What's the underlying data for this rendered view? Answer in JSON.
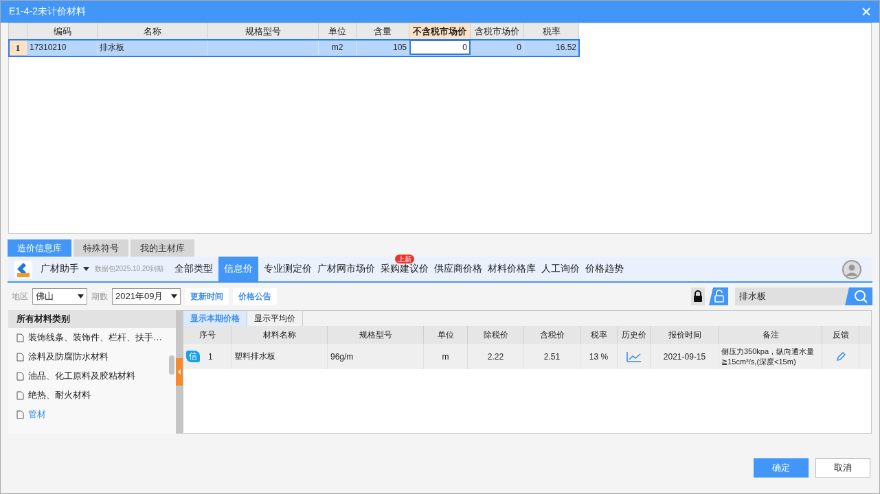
{
  "window": {
    "title": "E1-4-2未计价材料"
  },
  "top_table": {
    "columns": [
      {
        "label": "编码",
        "highlighted": false
      },
      {
        "label": "名称",
        "highlighted": false
      },
      {
        "label": "规格型号",
        "highlighted": false
      },
      {
        "label": "单位",
        "highlighted": false
      },
      {
        "label": "含量",
        "highlighted": false
      },
      {
        "label": "不含税市场价",
        "highlighted": true
      },
      {
        "label": "含税市场价",
        "highlighted": false
      },
      {
        "label": "税率",
        "highlighted": false
      }
    ],
    "rows": [
      {
        "number": "1",
        "selected": true,
        "cells": [
          "17310210",
          "排水板",
          "",
          "m2",
          "105",
          "0",
          "0",
          "16.52"
        ]
      }
    ]
  },
  "bottom_tabs": [
    {
      "label": "造价信息库",
      "selected": true
    },
    {
      "label": "特殊符号",
      "selected": false
    },
    {
      "label": "我的主材库",
      "selected": false
    }
  ],
  "assistant": {
    "name": "广材助手",
    "note": "数据包2025.10.20到期"
  },
  "nav": [
    {
      "label": "全部类型",
      "selected": false
    },
    {
      "label": "信息价",
      "selected": true
    },
    {
      "label": "专业测定价",
      "selected": false
    },
    {
      "label": "广材网市场价",
      "selected": false
    },
    {
      "label": "采购建议价",
      "selected": false,
      "badge": "上新"
    },
    {
      "label": "供应商价格",
      "selected": false
    },
    {
      "label": "材料价格库",
      "selected": false
    },
    {
      "label": "人工询价",
      "selected": false
    },
    {
      "label": "价格趋势",
      "selected": false
    }
  ],
  "filters": [
    {
      "label": "地区",
      "value": "佛山"
    },
    {
      "label": "期数",
      "value": "2021年09月"
    }
  ],
  "filter_buttons": [
    "更新时间",
    "价格公告"
  ],
  "search": {
    "value": "排水板"
  },
  "categories": {
    "header": "所有材料类别",
    "items": [
      {
        "label": "装饰线条、装饰件、栏杆、扶手…",
        "selected": false
      },
      {
        "label": "涂料及防腐防水材料",
        "selected": false
      },
      {
        "label": "油品、化工原料及胶粘材料",
        "selected": false
      },
      {
        "label": "绝热、耐火材料",
        "selected": false
      },
      {
        "label": "管材",
        "selected": true
      }
    ]
  },
  "sub_tabs": [
    {
      "label": "显示本期价格",
      "selected": true
    },
    {
      "label": "显示平均价",
      "selected": false
    }
  ],
  "price_table": {
    "columns": [
      "序号",
      "材料名称",
      "规格型号",
      "单位",
      "除税价",
      "含税价",
      "税率",
      "历史价",
      "报价时间",
      "备注",
      "反馈"
    ],
    "rows": [
      {
        "tag": "信",
        "cells": [
          "1",
          "塑料排水板",
          "96g/m",
          "m",
          "2.22",
          "2.51",
          "13 %",
          "",
          "2021-09-15",
          "侧压力350kpa，纵向通水量≧15cm³/s,(深度<15m)",
          ""
        ]
      }
    ]
  },
  "footer_buttons": [
    {
      "label": "确定",
      "kind": "primary"
    },
    {
      "label": "取消",
      "kind": "secondary"
    }
  ]
}
